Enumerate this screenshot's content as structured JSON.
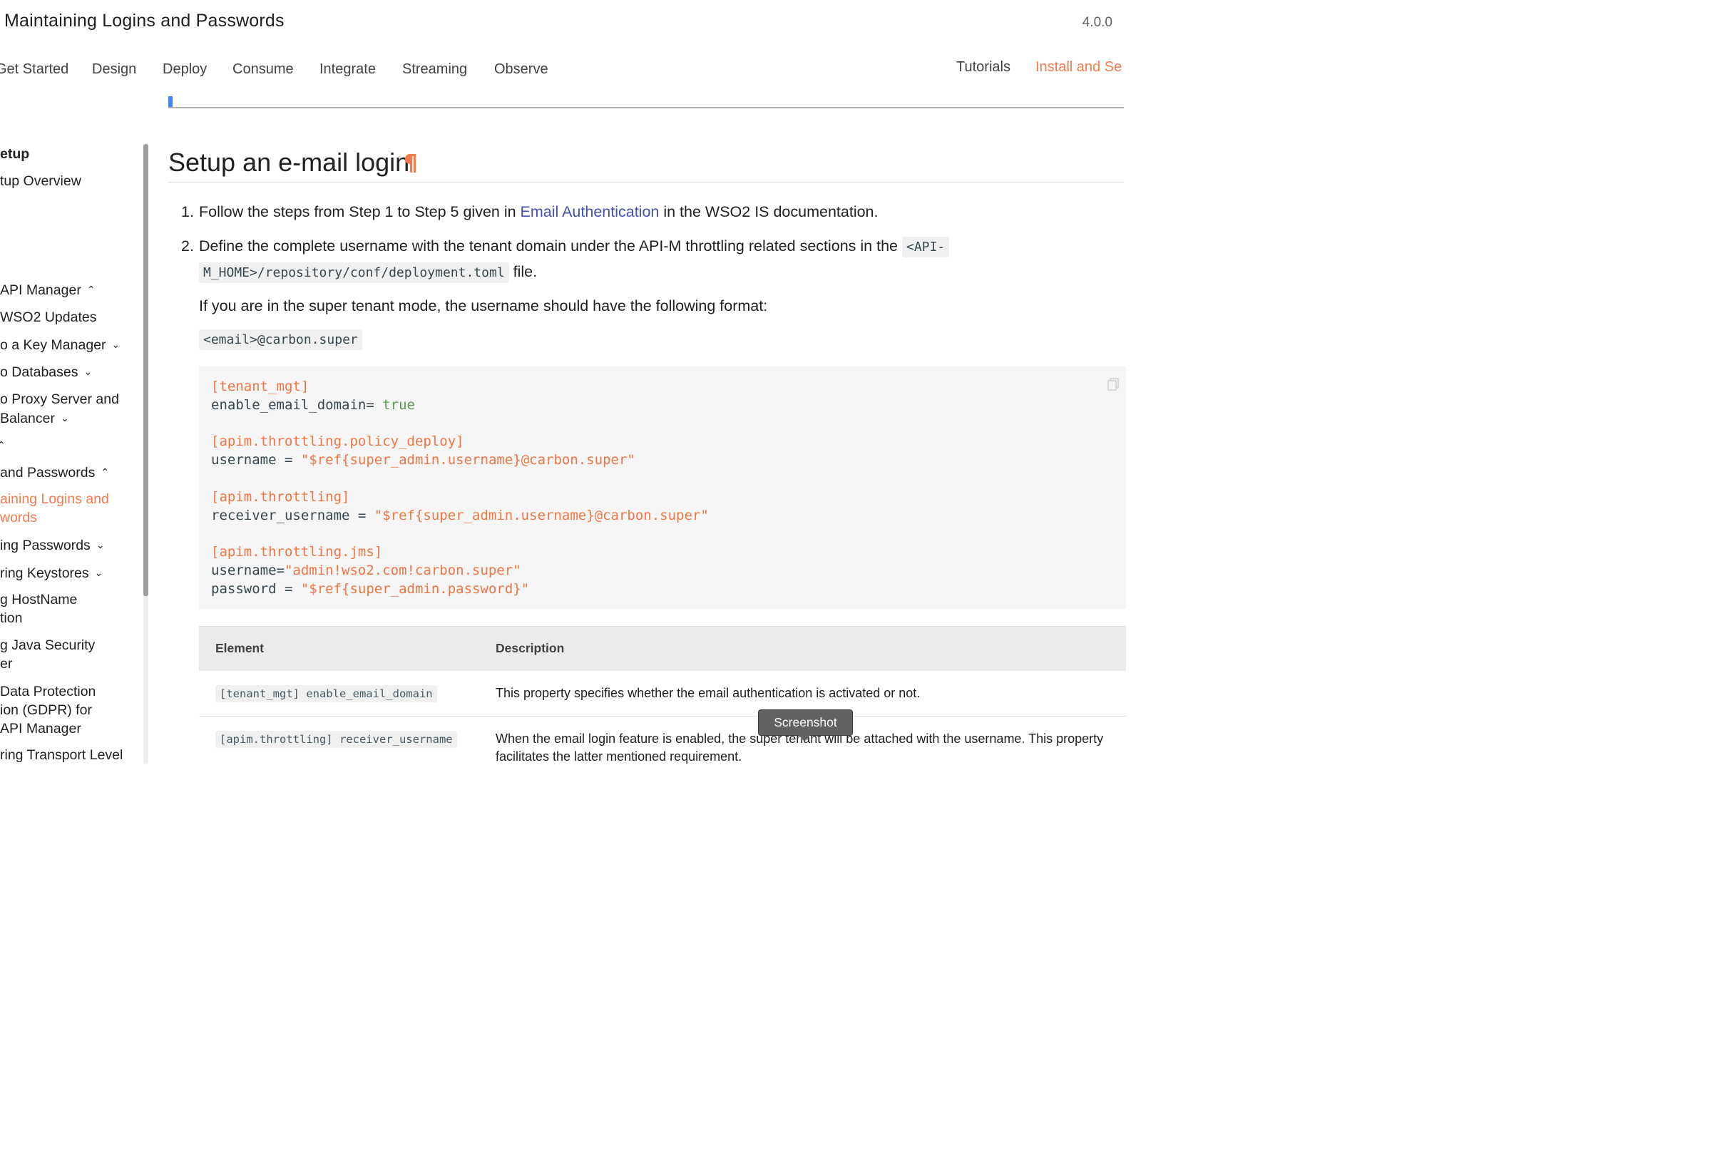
{
  "header": {
    "title": "Maintaining Logins and Passwords",
    "version": "4.0.0",
    "nav_tabs": [
      "Get Started",
      "Design",
      "Deploy",
      "Consume",
      "Integrate",
      "Streaming",
      "Observe"
    ],
    "right_links": [
      "Tutorials",
      "Install and Se"
    ],
    "active_right_link_color": "#f47b4e"
  },
  "sidebar": {
    "items": [
      {
        "label": "etup",
        "expanded": null
      },
      {
        "label": "tup Overview",
        "expanded": null
      },
      {
        "label": "API Manager",
        "expanded": true
      },
      {
        "label": "WSO2 Updates",
        "expanded": null
      },
      {
        "label": "o a Key Manager",
        "expanded": false
      },
      {
        "label": "o Databases",
        "expanded": false
      },
      {
        "label": "o Proxy Server and",
        "line2": "Balancer",
        "expanded": false
      },
      {
        "label": "",
        "expanded": true
      },
      {
        "label": "and Passwords",
        "expanded": true
      },
      {
        "label": "aining Logins and",
        "line2": "words",
        "active": true
      },
      {
        "label": "ing Passwords",
        "expanded": false
      },
      {
        "label": "ring Keystores",
        "expanded": false
      },
      {
        "label": "g HostName",
        "line2": "tion"
      },
      {
        "label": "g Java Security",
        "line2": "er"
      },
      {
        "label": " Data Protection",
        "line2": "ion (GDPR) for",
        "line3": "API Manager"
      },
      {
        "label": "ring Transport Level"
      }
    ],
    "scroll_position": 0.0
  },
  "content": {
    "heading": "Setup an e-mail login",
    "anchor_icon": "pilcrow-icon",
    "steps": [
      {
        "number": "1.",
        "text_before": "Follow the steps from Step 1 to Step 5 given in ",
        "link": "Email Authentication",
        "text_after": " in the WSO2 IS documentation."
      },
      {
        "number": "2.",
        "text_before": "Define the complete username with the tenant domain under the API-M throttling related sections in the ",
        "code_part1": "<API-",
        "code_part2": "M_HOME>/repository/conf/deployment.toml",
        "text_after": " file."
      }
    ],
    "note": "If you are in the super tenant mode, the username should have the following format:",
    "format_code": "<email>@carbon.super",
    "code_block": {
      "copy_icon": "copy-icon",
      "lines": [
        {
          "section": "[tenant_mgt]"
        },
        {
          "key": "enable_email_domain= ",
          "bool": "true"
        },
        {
          "blank": true
        },
        {
          "section": "[apim.throttling.policy_deploy]"
        },
        {
          "key": "username = ",
          "str": "\"$ref{super_admin.username}@carbon.super\""
        },
        {
          "blank": true
        },
        {
          "section": "[apim.throttling]"
        },
        {
          "key": "receiver_username = ",
          "str": "\"$ref{super_admin.username}@carbon.super\""
        },
        {
          "blank": true
        },
        {
          "section": "[apim.throttling.jms]"
        },
        {
          "key": "username=",
          "str": "\"admin!wso2.com!carbon.super\""
        },
        {
          "key": "password = ",
          "str": "\"$ref{super_admin.password}\""
        }
      ]
    },
    "table": {
      "headers": [
        "Element",
        "Description"
      ],
      "rows": [
        {
          "element": "[tenant_mgt] enable_email_domain",
          "description": "This property specifies whether the email authentication is activated or not."
        },
        {
          "element": "[apim.throttling] receiver_username",
          "description": "When the email login feature is enabled, the super tenant will be attached with the username. This property",
          "description_line2": "facilitates the latter mentioned requirement."
        }
      ]
    }
  },
  "tooltip": {
    "label": "Screenshot"
  }
}
